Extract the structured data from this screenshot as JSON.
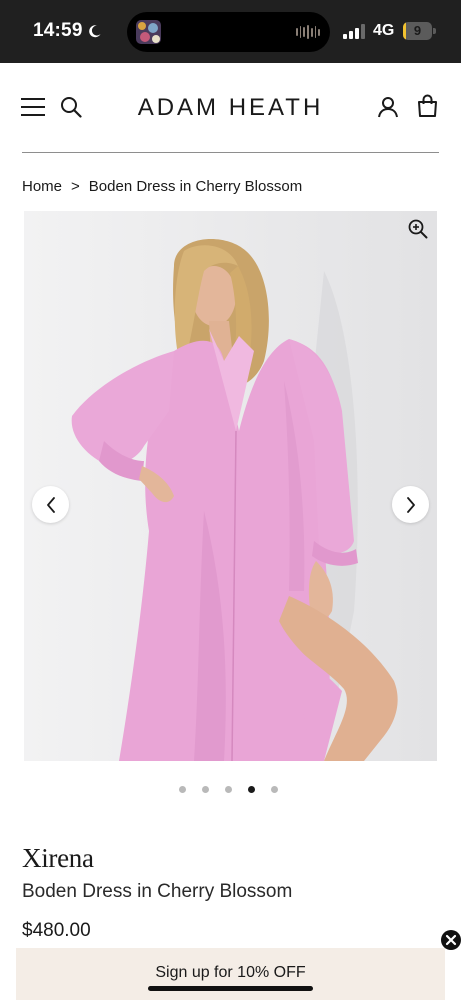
{
  "status_bar": {
    "time": "14:59",
    "network": "4G",
    "battery": "9",
    "battery_level": 0.09
  },
  "header": {
    "brand": "ADAM HEATH"
  },
  "breadcrumb": {
    "home": "Home",
    "separator": ">",
    "current": "Boden Dress in Cherry Blossom"
  },
  "gallery": {
    "slide_count": 5,
    "active_slide": 4
  },
  "product": {
    "brand": "Xirena",
    "title": "Boden Dress in Cherry Blossom",
    "price": "$480.00"
  },
  "signup": {
    "label": "Sign up for 10% OFF"
  },
  "colors": {
    "status_bar_bg": "#202020",
    "dress_pink": "#e9a5d6",
    "banner_bg": "#f4ede6",
    "gallery_bg": "#e9e9ea"
  }
}
